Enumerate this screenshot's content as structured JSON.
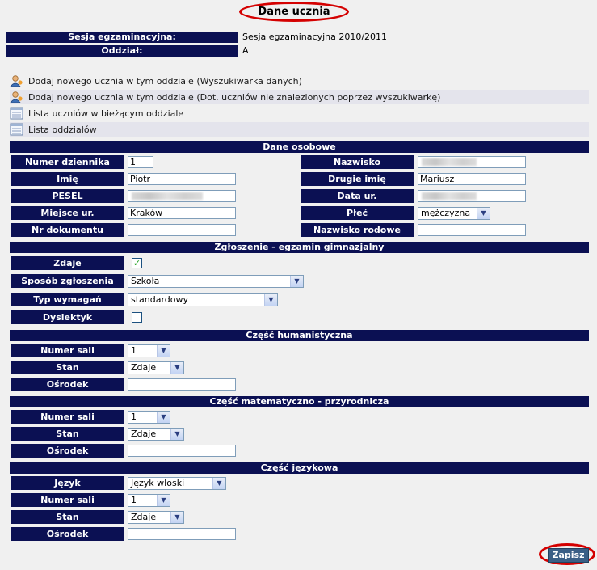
{
  "page_title": "Dane ucznia",
  "header": {
    "session_label": "Sesja egzaminacyjna:",
    "session_value": "Sesja egzaminacyjna 2010/2011",
    "branch_label": "Oddział:",
    "branch_value": "A"
  },
  "links": [
    {
      "label": "Dodaj nowego ucznia w tym oddziale (Wyszukiwarka danych)",
      "icon": "add-user-icon"
    },
    {
      "label": "Dodaj nowego ucznia w tym oddziale (Dot. uczniów nie znalezionych poprzez wyszukiwarkę)",
      "icon": "add-user-icon"
    },
    {
      "label": "Lista uczniów w bieżącym oddziale",
      "icon": "list-icon"
    },
    {
      "label": "Lista oddziałów",
      "icon": "list-icon"
    }
  ],
  "personal": {
    "section_title": "Dane osobowe",
    "log_number_label": "Numer dziennika",
    "log_number_value": "1",
    "first_name_label": "Imię",
    "first_name_value": "Piotr",
    "pesel_label": "PESEL",
    "birthplace_label": "Miejsce ur.",
    "birthplace_value": "Kraków",
    "doc_number_label": "Nr dokumentu",
    "doc_number_value": "",
    "surname_label": "Nazwisko",
    "second_name_label": "Drugie imię",
    "second_name_value": "Mariusz",
    "birth_date_label": "Data ur.",
    "sex_label": "Płeć",
    "sex_value": "mężczyzna",
    "maiden_name_label": "Nazwisko rodowe",
    "maiden_name_value": ""
  },
  "exam": {
    "section_title": "Zgłoszenie - egzamin gimnazjalny",
    "takes_label": "Zdaje",
    "takes_checked": true,
    "method_label": "Sposób zgłoszenia",
    "method_value": "Szkoła",
    "req_label": "Typ wymagań",
    "req_value": "standardowy",
    "dyslexic_label": "Dyslektyk",
    "dyslexic_checked": false
  },
  "humanities": {
    "section_title": "Część humanistyczna",
    "room_label": "Numer sali",
    "room_value": "1",
    "status_label": "Stan",
    "status_value": "Zdaje",
    "center_label": "Ośrodek",
    "center_value": ""
  },
  "math": {
    "section_title": "Część matematyczno - przyrodnicza",
    "room_label": "Numer sali",
    "room_value": "1",
    "status_label": "Stan",
    "status_value": "Zdaje",
    "center_label": "Ośrodek",
    "center_value": ""
  },
  "language": {
    "section_title": "Część językowa",
    "lang_label": "Język",
    "lang_value": "Język włoski",
    "room_label": "Numer sali",
    "room_value": "1",
    "status_label": "Stan",
    "status_value": "Zdaje",
    "center_label": "Ośrodek",
    "center_value": ""
  },
  "save_label": "Zapisz",
  "colors": {
    "header_bg": "#0b1053",
    "highlight_ring": "#d40000",
    "save_bg": "#3a5f86"
  }
}
